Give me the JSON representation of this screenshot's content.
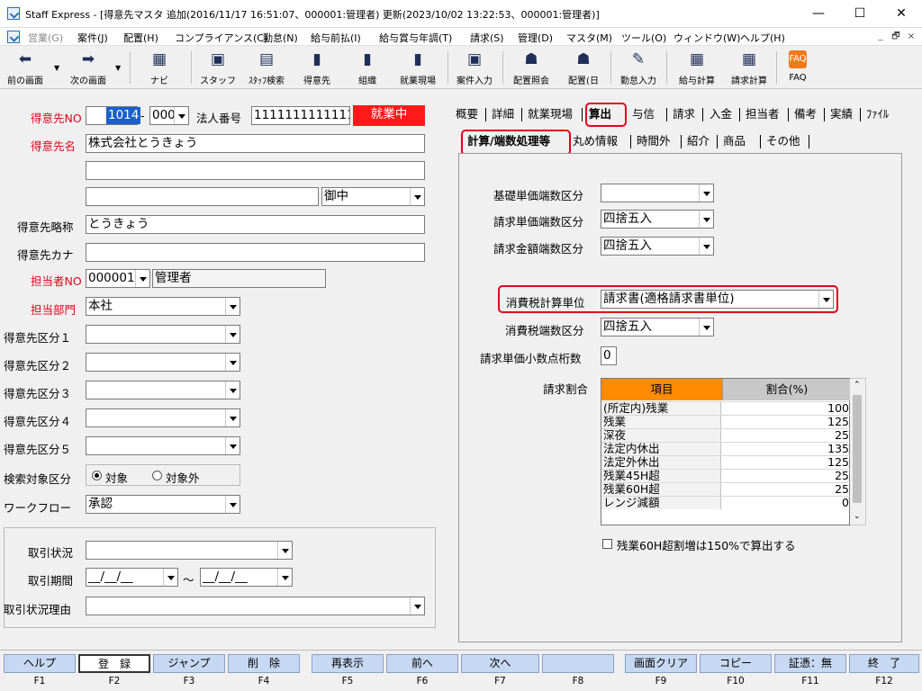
{
  "window": {
    "title": "Staff Express - [得意先マスタ 追加(2016/11/17 16:51:07、000001:管理者) 更新(2023/10/02 13:22:53、000001:管理者)]",
    "minimize": "—",
    "maximize": "☐",
    "close": "✕"
  },
  "menu": {
    "items": [
      "営業(G)",
      "案件(J)",
      "配置(H)",
      "コンプライアンス(C)",
      "勤怠(N)",
      "給与前払(I)",
      "給与賞与年調(T)",
      "請求(S)",
      "管理(D)",
      "マスタ(M)",
      "ツール(O)",
      "ウィンドウ(W)",
      "ヘルプ(H)"
    ],
    "mdi_min": "_",
    "mdi_restore": "🗗",
    "mdi_close": "×"
  },
  "toolbar": {
    "items": [
      "前の画面",
      "次の画面",
      "ナビ",
      "スタッフ",
      "ｽﾀｯﾌ検索",
      "得意先",
      "組織",
      "就業現場",
      "案件入力",
      "配置照会",
      "配置(日",
      "勤怠入力",
      "給与計算",
      "請求計算",
      "FAQ"
    ]
  },
  "form": {
    "client_no_label": "得意先NO",
    "client_no": "1014",
    "dash": "-",
    "branch_no": "000",
    "corp_no_label": "法人番号",
    "corp_no": "1111111111111",
    "status": "就業中",
    "client_name_label": "得意先名",
    "client_name": "株式会社とうきょう",
    "client_name2": "",
    "client_name3": "",
    "honorific": "御中",
    "short_name_label": "得意先略称",
    "short_name": "とうきょう",
    "kana_label": "得意先カナ",
    "kana": "",
    "staff_no_label": "担当者NO",
    "staff_no": "000001",
    "staff_name": "管理者",
    "dept_label": "担当部門",
    "dept": "本社",
    "class_labels": [
      "得意先区分１",
      "得意先区分２",
      "得意先区分３",
      "得意先区分４",
      "得意先区分５"
    ],
    "search_label": "検索対象区分",
    "search_on": "対象",
    "search_off": "対象外",
    "workflow_label": "ワークフロー",
    "workflow": "承認",
    "trade_status_label": "取引状況",
    "trade_period_label": "取引期間",
    "date_placeholder": "__/__/__",
    "tilde": "～",
    "trade_reason_label": "取引状況理由"
  },
  "tabs": {
    "main": [
      "概要",
      "詳細",
      "就業現場",
      "算出",
      "与信",
      "請求",
      "入金",
      "担当者",
      "備考",
      "実績",
      "ﾌｧｲﾙ"
    ],
    "sub": [
      "計算/端数処理等",
      "丸め情報",
      "時間外",
      "紹介",
      "商品",
      "その他"
    ]
  },
  "calc": {
    "base_rounding_label": "基礎単価端数区分",
    "base_rounding": "",
    "bill_unit_rounding_label": "請求単価端数区分",
    "bill_unit_rounding": "四捨五入",
    "bill_amount_rounding_label": "請求金額端数区分",
    "bill_amount_rounding": "四捨五入",
    "tax_unit_label": "消費税計算単位",
    "tax_unit": "請求書(適格請求書単位)",
    "tax_rounding_label": "消費税端数区分",
    "tax_rounding": "四捨五入",
    "decimals_label": "請求単価小数点桁数",
    "decimals": "0",
    "ratio_label": "請求割合",
    "grid_headers": [
      "項目",
      "割合(%)"
    ],
    "rows": [
      {
        "item": "(所定内)残業",
        "pct": "100"
      },
      {
        "item": "残業",
        "pct": "125"
      },
      {
        "item": "深夜",
        "pct": "25"
      },
      {
        "item": "法定内休出",
        "pct": "135"
      },
      {
        "item": "法定外休出",
        "pct": "125"
      },
      {
        "item": "残業45H超",
        "pct": "25"
      },
      {
        "item": "残業60H超",
        "pct": "25"
      },
      {
        "item": "レンジ減額",
        "pct": "0"
      }
    ],
    "checkbox_label": "残業60H超割増は150%で算出する"
  },
  "fkeys": {
    "labels": [
      "ヘルプ",
      "登　録",
      "ジャンプ",
      "削　除",
      "再表示",
      "前へ",
      "次へ",
      "",
      "画面クリア",
      "コピー",
      "証憑：無",
      "終　了"
    ],
    "keys": [
      "F1",
      "F2",
      "F3",
      "F4",
      "F5",
      "F6",
      "F7",
      "F8",
      "F9",
      "F10",
      "F11",
      "F12"
    ]
  },
  "colors": {
    "status_bg": "#ff1a1a",
    "required_label": "#e8001c",
    "highlight": "#e8001c",
    "grid_header": "#ff8c00",
    "fkey_bg": "#c7d8f2"
  }
}
